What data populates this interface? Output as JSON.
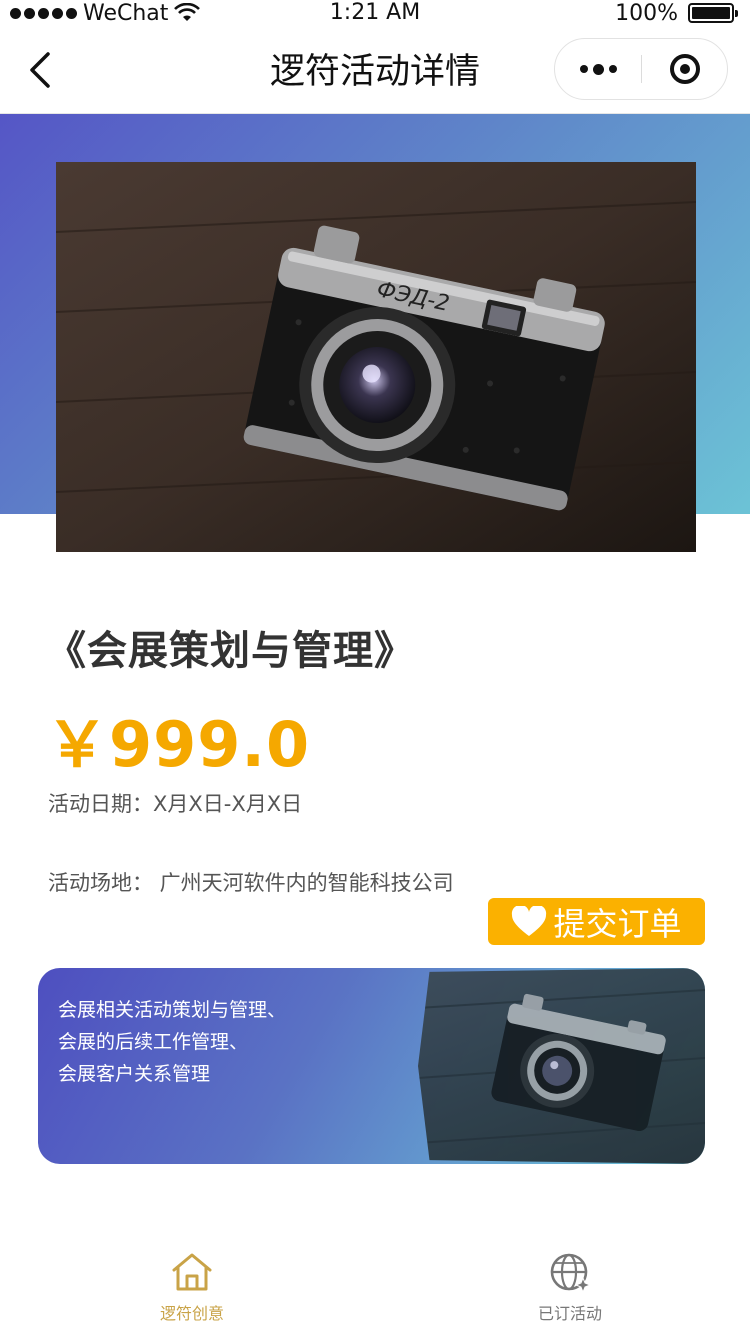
{
  "status_bar": {
    "carrier": "WeChat",
    "time": "1:21 AM",
    "battery": "100%"
  },
  "nav": {
    "title": "逻符活动详情"
  },
  "event": {
    "title": "《会展策划与管理》",
    "price": "￥999.0",
    "date": "活动日期：X月X日-X月X日",
    "venue": "活动场地：  广州天河软件内的智能科技公司",
    "submit_label": "提交订单"
  },
  "promo": {
    "lines": [
      "会展相关活动策划与管理、",
      "会展的后续工作管理、",
      "会展客户关系管理"
    ]
  },
  "tabs": [
    {
      "label": "逻符创意",
      "icon": "home-icon",
      "active": true,
      "color": "#c9a347"
    },
    {
      "label": "已订活动",
      "icon": "globe-icon",
      "active": false,
      "color": "#777777"
    }
  ],
  "colors": {
    "accent": "#fbb100",
    "price": "#f5a800",
    "gradient_start": "#5556c6",
    "gradient_end": "#6cc3d6"
  },
  "camera_label": "ФЭД-2"
}
